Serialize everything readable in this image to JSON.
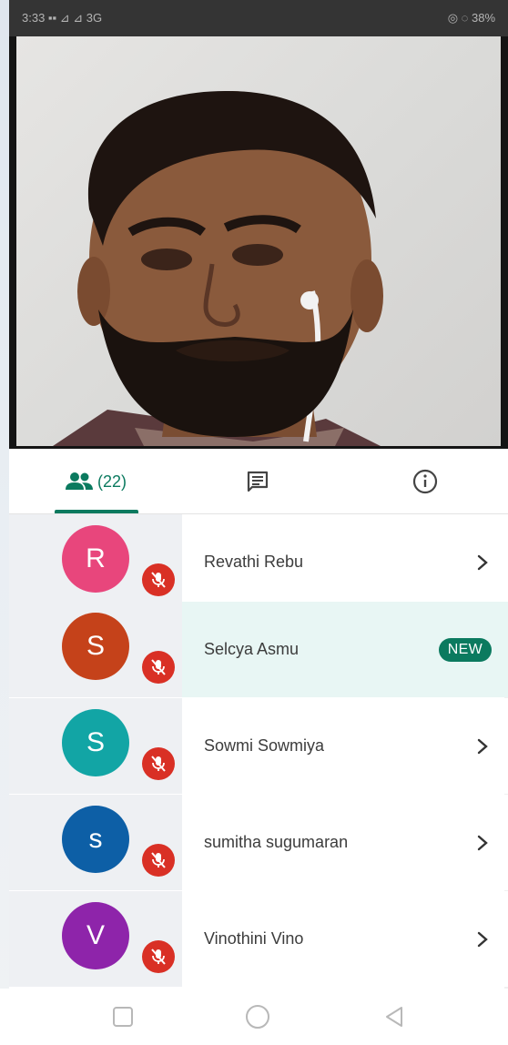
{
  "status_bar": {
    "left": "3:33 ▪▪ ⊿ ⊿ 3G",
    "right": "◎ ◌ 38%"
  },
  "tabs": {
    "people_count": "(22)",
    "active": "people"
  },
  "participants": [
    {
      "initial": "R",
      "name": "Revathi Rebu",
      "color": "#e8467c",
      "muted": true,
      "badge": null
    },
    {
      "initial": "S",
      "name": "Selcya Asmu",
      "color": "#c5421a",
      "muted": true,
      "badge": "NEW"
    },
    {
      "initial": "S",
      "name": "Sowmi Sowmiya",
      "color": "#12a5a5",
      "muted": true,
      "badge": null
    },
    {
      "initial": "s",
      "name": "sumitha sugumaran",
      "color": "#0d5fa6",
      "muted": true,
      "badge": null
    },
    {
      "initial": "V",
      "name": "Vinothini Vino",
      "color": "#8e24aa",
      "muted": true,
      "badge": null
    }
  ],
  "colors": {
    "accent": "#0b7a5f",
    "mute": "#d93025",
    "highlight_row": "#e8f6f4"
  },
  "icons": [
    "people-icon",
    "chat-icon",
    "info-icon",
    "mic-off-icon",
    "chevron-right-icon",
    "nav-recents-icon",
    "nav-home-icon",
    "nav-back-icon"
  ]
}
